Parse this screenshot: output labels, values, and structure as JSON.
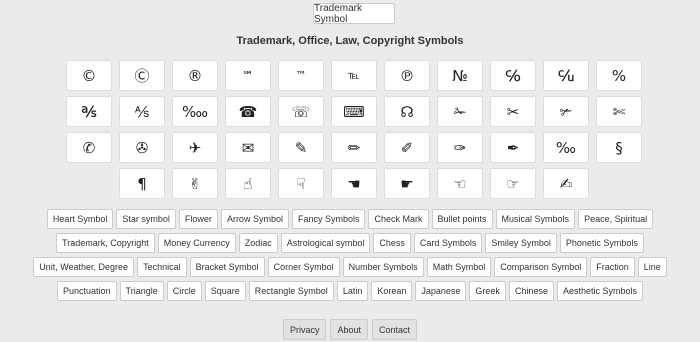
{
  "header": {
    "button_label": "Trademark Symbol",
    "title": "Trademark, Office, Law, Copyright Symbols"
  },
  "symbol_rows": [
    [
      "©",
      "Ⓒ",
      "®",
      "℠",
      "™",
      "℡",
      "℗",
      "№",
      "℅",
      "℆",
      "%"
    ],
    [
      "℁",
      "⅍",
      "‱",
      "☎",
      "☏",
      "⌨",
      "☊",
      "✁",
      "✂",
      "✃",
      "✄"
    ],
    [
      "✆",
      "✇",
      "✈",
      "✉",
      "✎",
      "✏",
      "✐",
      "✑",
      "✒",
      "‰",
      "§"
    ],
    [
      "¶",
      "✌",
      "☝",
      "☟",
      "☚",
      "☛",
      "☜",
      "☞",
      "✍"
    ]
  ],
  "categories": [
    [
      "Heart Symbol",
      "Star symbol",
      "Flower",
      "Arrow Symbol",
      "Fancy Symbols",
      "Check Mark",
      "Bullet points",
      "Musical Symbols",
      "Peace, Spiritual"
    ],
    [
      "Trademark, Copyright",
      "Money Currency",
      "Zodiac",
      "Astrological symbol",
      "Chess",
      "Card Symbols",
      "Smiley Symbol",
      "Phonetic Symbols"
    ],
    [
      "Unit, Weather, Degree",
      "Technical",
      "Bracket Symbol",
      "Corner Symbol",
      "Number Symbols",
      "Math Symbol",
      "Comparison Symbol",
      "Fraction",
      "Line"
    ],
    [
      "Punctuation",
      "Triangle",
      "Circle",
      "Square",
      "Rectangle Symbol",
      "Latin",
      "Korean",
      "Japanese",
      "Greek",
      "Chinese",
      "Aesthetic Symbols"
    ]
  ],
  "footer": {
    "privacy": "Privacy",
    "about": "About",
    "contact": "Contact"
  }
}
